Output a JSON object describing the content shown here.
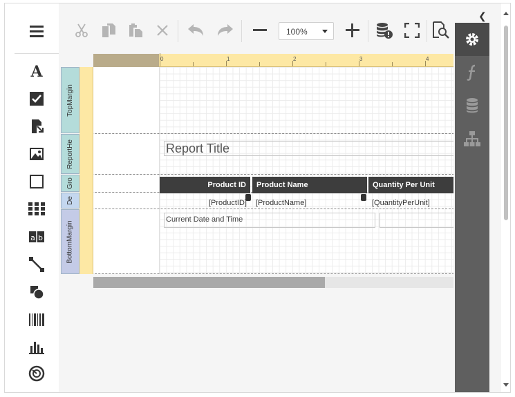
{
  "toolbar": {
    "zoom_value": "100%",
    "buttons": [
      "cut",
      "copy",
      "paste",
      "delete",
      "undo",
      "redo",
      "zoom-out",
      "zoom-in",
      "validate-bindings",
      "full-screen",
      "preview"
    ]
  },
  "ruler": {
    "numbers": [
      "0",
      "1",
      "2",
      "3",
      "4"
    ]
  },
  "bands": {
    "top_margin": "TopMargin",
    "report_header": "ReportHe",
    "group_header": "Gro",
    "detail": "De",
    "bottom_margin": "BottomMargin"
  },
  "report": {
    "title": "Report Title",
    "headers": [
      "Product ID",
      "Product Name",
      "Quantity Per Unit"
    ],
    "fields": [
      "[ProductID]",
      "[ProductName]",
      "[QuantityPerUnit]"
    ],
    "footer_date": "Current Date and Time"
  },
  "right_panel": {
    "items": [
      "properties",
      "expressions",
      "field-list",
      "report-explorer"
    ],
    "active": "properties"
  },
  "colors": {
    "ruler": "#fde8a4",
    "top_margin_band": "#b4dcda",
    "report_header_band": "#b4dcda",
    "group_header_band": "#b4dcda",
    "detail_band": "#c4d7ef",
    "bottom_margin_band": "#c4cbe7",
    "panel": "#5f5f5f",
    "table_header": "#3d3d3d"
  }
}
